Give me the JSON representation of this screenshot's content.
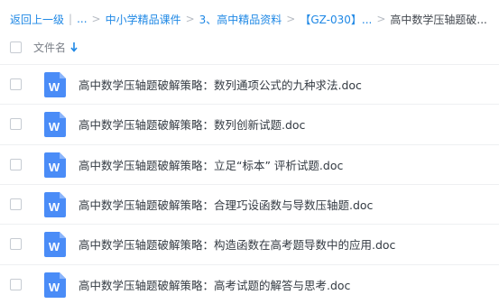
{
  "breadcrumb": {
    "back": "返回上一级",
    "sep": "|",
    "ellipsis": "...",
    "arrow": ">",
    "items": [
      "中小学精品课件",
      "3、高中精品资料",
      "【GZ-030】..."
    ],
    "current": "高中数学压轴题破..."
  },
  "header": {
    "column_name": "文件名",
    "sort_icon": "arrow-down-icon"
  },
  "files": [
    {
      "name": "高中数学压轴题破解策略：数列通项公式的九种求法.doc",
      "icon": "word-doc-icon"
    },
    {
      "name": "高中数学压轴题破解策略：数列创新试题.doc",
      "icon": "word-doc-icon"
    },
    {
      "name": "高中数学压轴题破解策略：立足“标本” 评析试题.doc",
      "icon": "word-doc-icon"
    },
    {
      "name": "高中数学压轴题破解策略：合理巧设函数与导数压轴题.doc",
      "icon": "word-doc-icon"
    },
    {
      "name": "高中数学压轴题破解策略：构造函数在高考题导数中的应用.doc",
      "icon": "word-doc-icon"
    },
    {
      "name": "高中数学压轴题破解策略：高考试题的解答与思考.doc",
      "icon": "word-doc-icon"
    }
  ],
  "colors": {
    "link": "#1f88e5",
    "doc_icon": "#4a8cf7"
  }
}
